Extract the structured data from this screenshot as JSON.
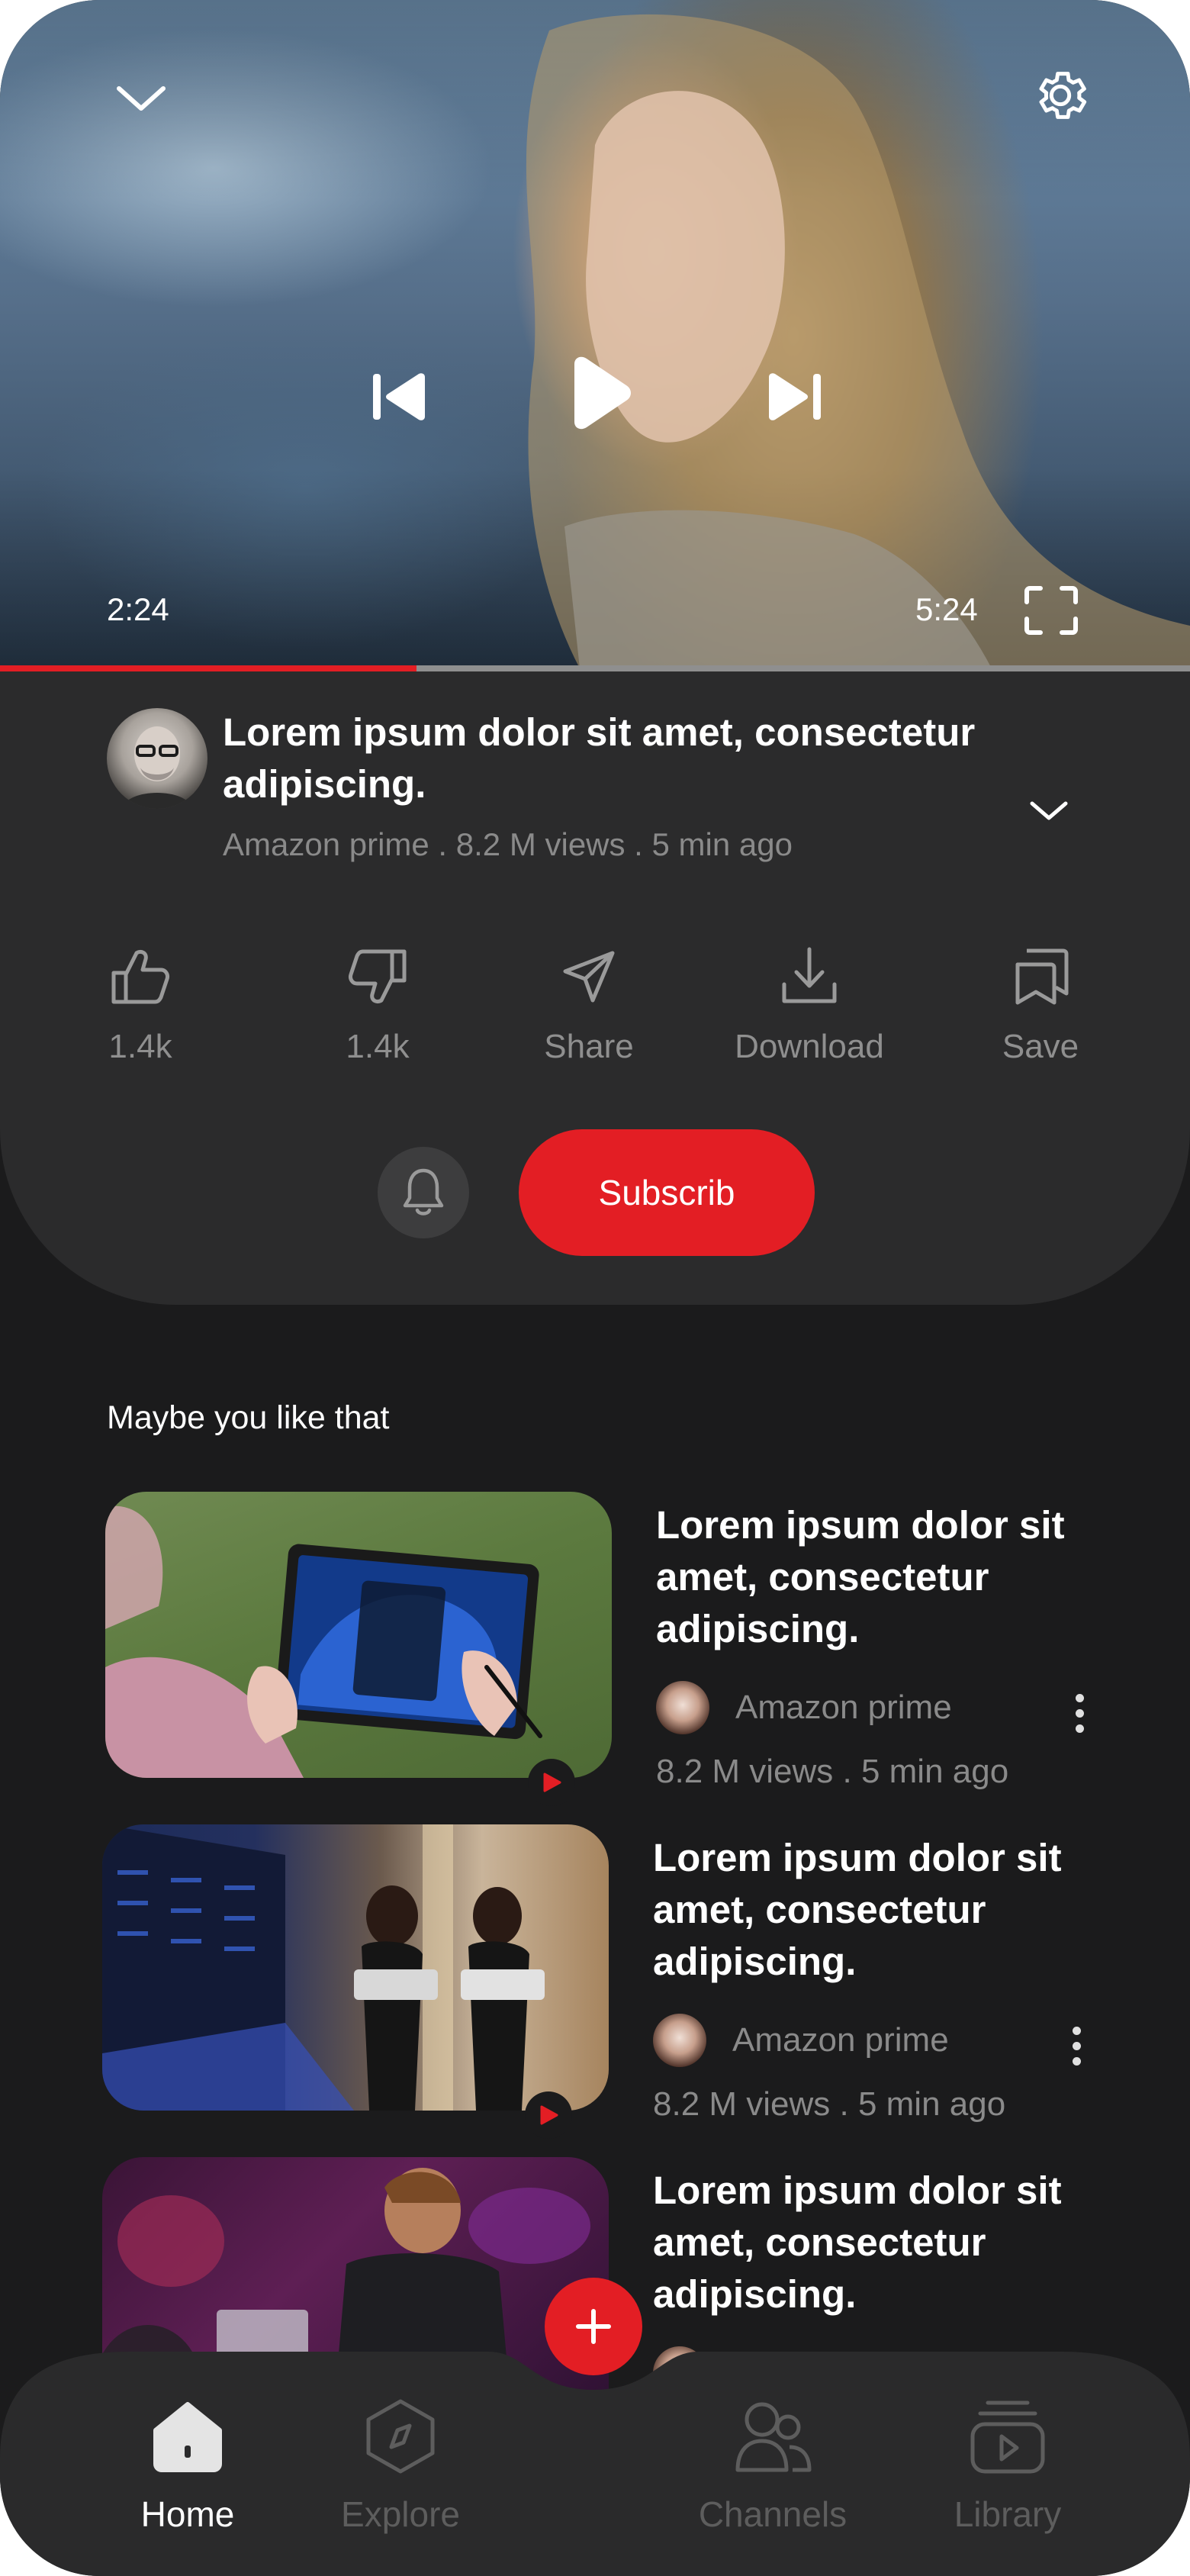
{
  "player": {
    "current_time": "2:24",
    "duration": "5:24",
    "progress": 0.35
  },
  "video": {
    "title": "Lorem ipsum dolor sit amet, consectetur adipiscing.",
    "meta": "Amazon prime . 8.2 M views . 5 min ago"
  },
  "actions": {
    "like": "1.4k",
    "dislike": "1.4k",
    "share": "Share",
    "download": "Download",
    "save": "Save"
  },
  "subscribe": {
    "label": "Subscrib"
  },
  "section": {
    "title": "Maybe you like that"
  },
  "recommendations": [
    {
      "title": "Lorem ipsum dolor sit amet, consectetur adipiscing.",
      "channel": "Amazon prime",
      "stats": "8.2 M views . 5 min ago"
    },
    {
      "title": "Lorem ipsum dolor sit amet, consectetur adipiscing.",
      "channel": "Amazon prime",
      "stats": "8.2 M views . 5 min ago"
    },
    {
      "title": "Lorem ipsum dolor sit amet, consectetur adipiscing.",
      "channel": "",
      "stats": ""
    }
  ],
  "nav": {
    "home": "Home",
    "explore": "Explore",
    "channels": "Channels",
    "library": "Library"
  },
  "colors": {
    "accent": "#e31e24",
    "background": "#1b1b1c",
    "card": "#2b2b2c",
    "muted_text": "#8a8a8a"
  },
  "icons": [
    "chevron-down-icon",
    "gear-icon",
    "skip-previous-icon",
    "play-icon",
    "skip-next-icon",
    "fullscreen-icon",
    "thumbs-up-icon",
    "thumbs-down-icon",
    "share-icon",
    "download-icon",
    "save-icon",
    "bell-icon",
    "more-vertical-icon",
    "plus-icon",
    "home-icon",
    "explore-icon",
    "channels-icon",
    "library-icon"
  ]
}
